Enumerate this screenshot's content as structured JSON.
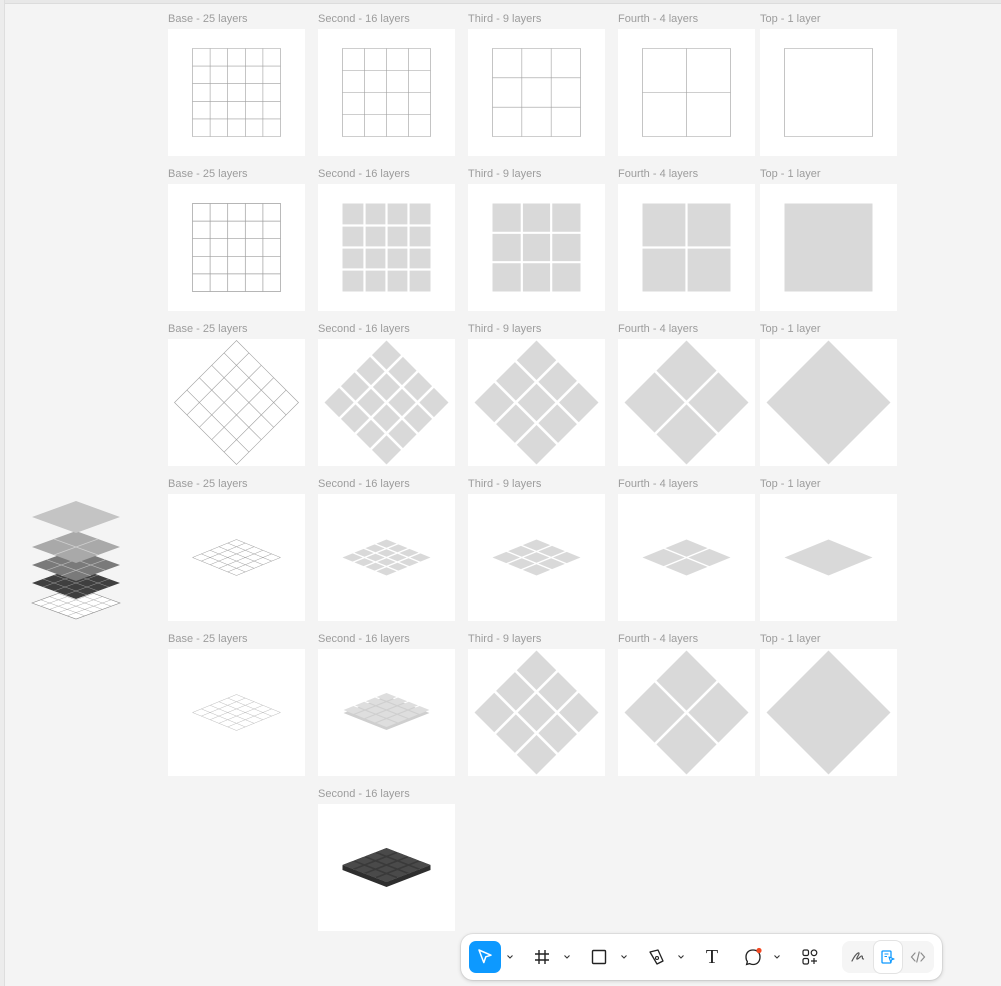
{
  "canvas": {
    "rows": [
      [
        "Base - 25 layers",
        "Second - 16 layers",
        "Third - 9 layers",
        "Fourth - 4 layers",
        "Top - 1 layer"
      ],
      [
        "Base - 25 layers",
        "Second - 16 layers",
        "Third - 9 layers",
        "Fourth - 4 layers",
        "Top - 1 layer"
      ],
      [
        "Base - 25 layers",
        "Second - 16 layers",
        "Third - 9 layers",
        "Fourth - 4 layers",
        "Top - 1 layer"
      ],
      [
        "Base - 25 layers",
        "Second - 16 layers",
        "Third - 9 layers",
        "Fourth - 4 layers",
        "Top - 1 layer"
      ],
      [
        "Base - 25 layers",
        "Second - 16 layers",
        "Third - 9 layers",
        "Fourth - 4 layers",
        "Top - 1 layer"
      ],
      [
        "",
        "Second - 16 layers",
        "",
        "",
        ""
      ]
    ],
    "colors": {
      "canvas": "#f4f4f4",
      "frame": "#ffffff",
      "tile": "#d9d9d9",
      "gridline": "#9e9e9e",
      "dark_tile": "#4a4a4a",
      "accent": "#0d99ff"
    }
  },
  "toolbar": {
    "tools": [
      {
        "icon": "move-pointer-icon",
        "active": true
      },
      {
        "icon": "frame-hash-icon",
        "active": false
      },
      {
        "icon": "rectangle-icon",
        "active": false
      },
      {
        "icon": "pen-icon",
        "active": false
      },
      {
        "icon": "text-icon",
        "glyph": "T",
        "active": false
      },
      {
        "icon": "comment-icon",
        "active": false
      },
      {
        "icon": "actions-icon",
        "active": false
      }
    ],
    "modes": [
      {
        "icon": "draw-mode-icon",
        "active": false
      },
      {
        "icon": "design-mode-icon",
        "active": true
      },
      {
        "icon": "dev-mode-icon",
        "active": false
      }
    ]
  }
}
